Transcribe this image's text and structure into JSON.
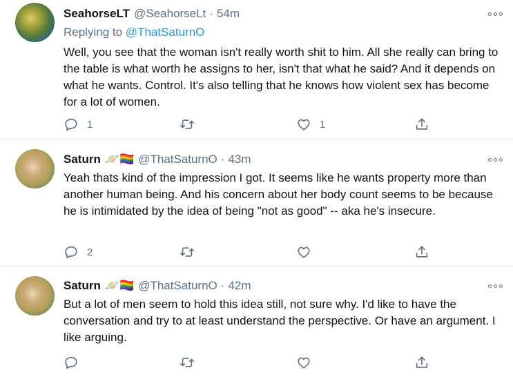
{
  "tweets": [
    {
      "display_name": "SeahorseLT",
      "handle": "@SeahorseLt",
      "separator": "·",
      "time": "54m",
      "replying_prefix": "Replying to",
      "replying_to": "@ThatSaturnO",
      "text": "Well, you see that the woman isn't really worth shit to him. All she really can bring to the table is what worth he assigns to her, isn't that what he said? And it depends on what he wants. Control. It's also telling that he knows how violent sex has become for a lot of women.",
      "reply_count": "1",
      "retweet_count": "",
      "like_count": "1",
      "avatar_icon": "seahorse-avatar"
    },
    {
      "display_name": "Saturn",
      "emojis": "🪐🏳️‍🌈",
      "handle": "@ThatSaturnO",
      "separator": "·",
      "time": "43m",
      "text": "Yeah thats kind of the impression I got. It seems like he wants property more than another human being. And his concern about her body count seems to be because he is intimidated by the idea of being \"not as good\" -- aka he's insecure.",
      "reply_count": "2",
      "retweet_count": "",
      "like_count": "",
      "avatar_icon": "saturn-avatar"
    },
    {
      "display_name": "Saturn",
      "emojis": "🪐🏳️‍🌈",
      "handle": "@ThatSaturnO",
      "separator": "·",
      "time": "42m",
      "text": "But a lot of men seem to hold this idea still, not sure why. I'd like to have the conversation and try to at least understand the perspective. Or have an argument. I like arguing.",
      "reply_count": "",
      "retweet_count": "",
      "like_count": "",
      "avatar_icon": "saturn-avatar"
    }
  ],
  "colors": {
    "text": "#0f1419",
    "secondary": "#5b7083",
    "link": "#1d9bf0",
    "divider": "#e6ecf0"
  },
  "icons": [
    "reply-icon",
    "retweet-icon",
    "like-icon",
    "share-icon",
    "more-icon"
  ]
}
